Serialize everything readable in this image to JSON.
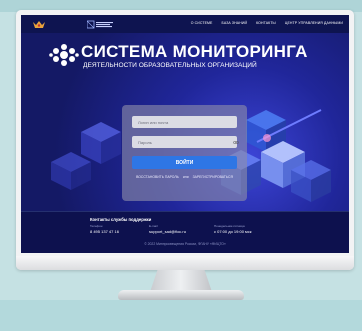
{
  "site": {
    "nav": [
      "О СИСТЕМЕ",
      "БАЗА ЗНАНИЙ",
      "КОНТАКТЫ",
      "ЦЕНТР УПРАВЛЕНИЯ ДАННЫМИ"
    ],
    "title_main": "СИСТЕМА МОНИТОРИНГА",
    "title_sub": "ДЕЯТЕЛЬНОСТИ ОБРАЗОВАТЕЛЬНЫХ ОРГАНИЗАЦИЙ"
  },
  "login": {
    "login_placeholder": "Логин или почта",
    "password_placeholder": "Пароль",
    "submit_label": "ВОЙТИ",
    "restore_label": "ВОССТАНОВИТЬ ПАРОЛЬ",
    "or_label": "или",
    "register_label": "ЗАРЕГИСТРИРОВАТЬСЯ"
  },
  "footer": {
    "support_title": "Контакты службы поддержки",
    "phone_label": "Телефон",
    "phone": "8 495 137 47 16",
    "email_label": "E-mail",
    "email": "support_sad@fioc.ru",
    "hours_label": "Понедельник-пятница",
    "hours": "с 07:00 до 19:00 мск",
    "copyright": "© 2022 Минпросвещения России, ФГАНУ «ФИЦТО»"
  },
  "colors": {
    "screen_background": "#13175a",
    "button": "#2e76e5",
    "frame_background": "#c5e1e3"
  }
}
